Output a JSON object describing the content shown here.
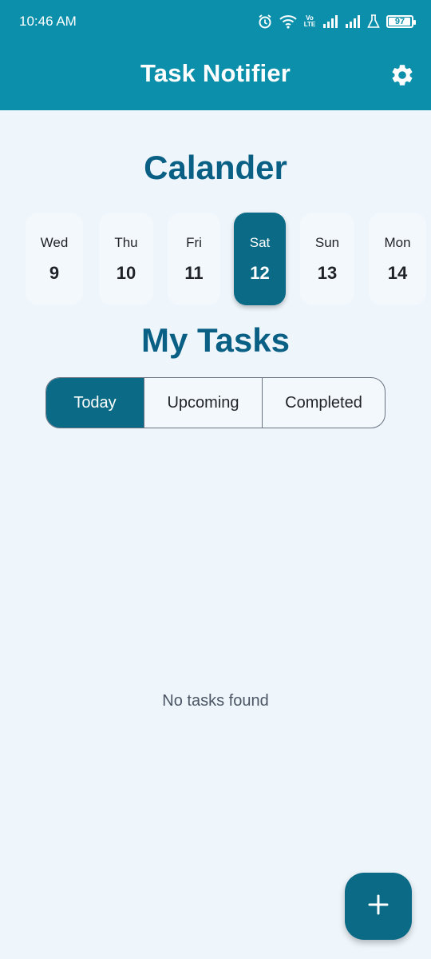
{
  "status_bar": {
    "time": "10:46 AM",
    "volte_label": "Vo LTE",
    "battery_level": "97",
    "icons": [
      "alarm-icon",
      "wifi-icon",
      "volte-icon",
      "signal-icon",
      "signal-icon",
      "lab-icon",
      "battery-icon"
    ]
  },
  "app_bar": {
    "title": "Task Notifier",
    "settings_icon": "gear-icon"
  },
  "calendar": {
    "title": "Calander",
    "selected_index": 3,
    "days": [
      {
        "day": "Wed",
        "date": "9"
      },
      {
        "day": "Thu",
        "date": "10"
      },
      {
        "day": "Fri",
        "date": "11"
      },
      {
        "day": "Sat",
        "date": "12"
      },
      {
        "day": "Sun",
        "date": "13"
      },
      {
        "day": "Mon",
        "date": "14"
      }
    ]
  },
  "tasks": {
    "title": "My Tasks",
    "tabs": [
      {
        "label": "Today",
        "active": true
      },
      {
        "label": "Upcoming",
        "active": false
      },
      {
        "label": "Completed",
        "active": false
      }
    ],
    "empty_message": "No tasks found"
  },
  "fab": {
    "icon": "plus-icon"
  },
  "colors": {
    "app_bar": "#0b8fab",
    "primary": "#0b6a85",
    "heading": "#0a5f85",
    "background": "#eef6fc"
  }
}
